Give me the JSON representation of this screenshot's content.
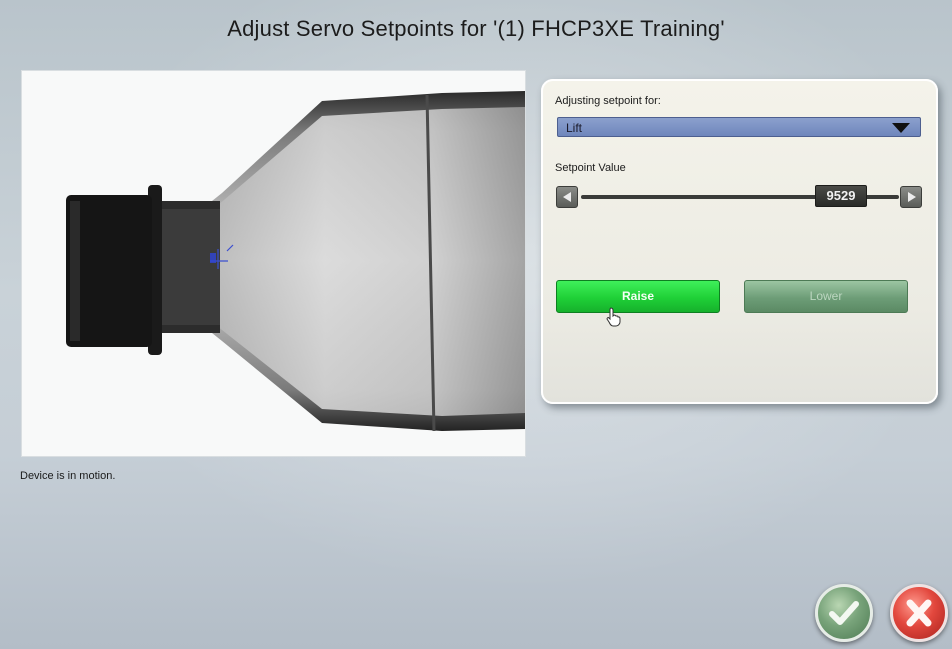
{
  "window": {
    "title": "Adjust Servo Setpoints for '(1) FHCP3XE Training'"
  },
  "status": {
    "text": "Device is in motion."
  },
  "setpoint_panel": {
    "adjusting_label": "Adjusting setpoint for:",
    "selected_servo": "Lift",
    "setpoint_label": "Setpoint Value",
    "setpoint_value": "9529",
    "slider_level_fraction": 0.88,
    "raise_label": "Raise",
    "lower_label": "Lower"
  },
  "icons": {
    "decrement": "chevron-left-icon",
    "increment": "chevron-right-icon",
    "dropdown": "caret-down-icon",
    "ok": "checkmark-icon",
    "cancel": "x-icon",
    "pointer": "hand-pointer-icon"
  },
  "colors": {
    "raise_green": "#1fd037",
    "lower_disabled_green": "#6d9d77",
    "dropdown_blue": "#7b8fc4",
    "ok_green": "#78a37a",
    "cancel_red": "#e2473d"
  }
}
